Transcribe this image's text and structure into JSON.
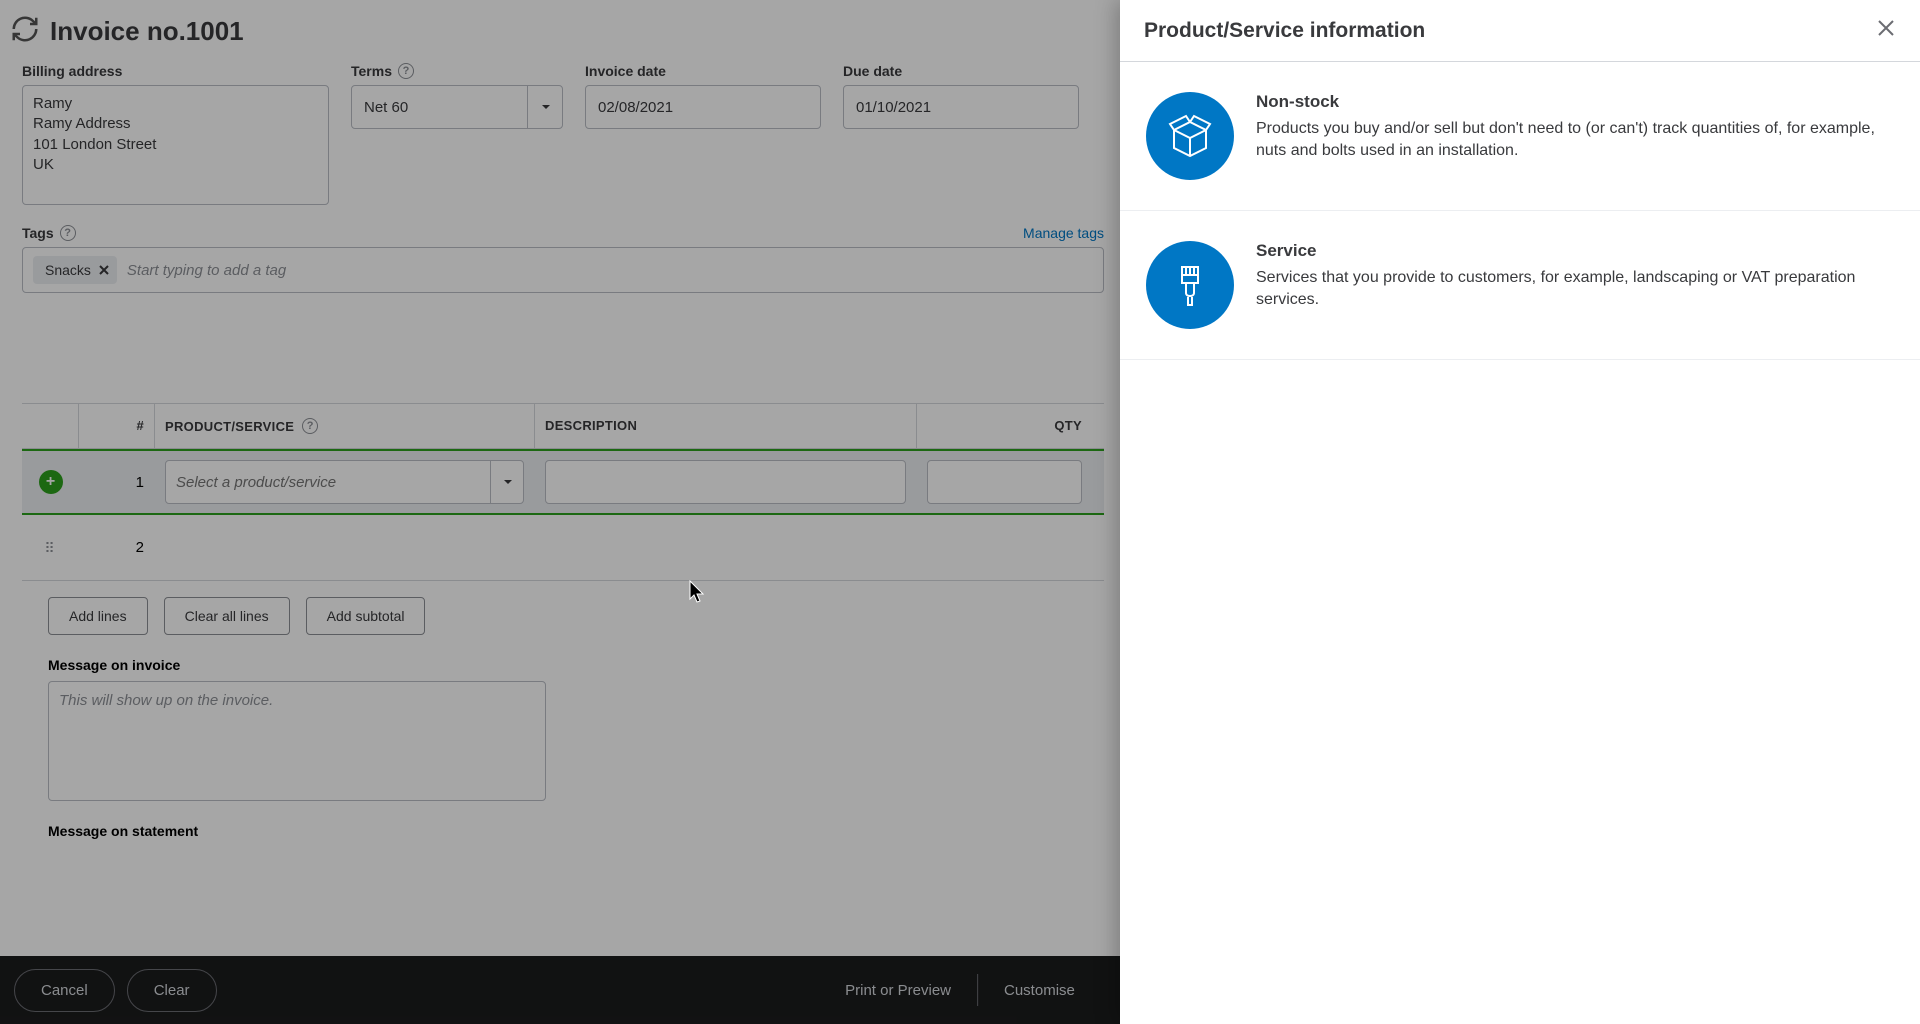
{
  "header": {
    "title": "Invoice no.1001"
  },
  "fields": {
    "billing_label": "Billing address",
    "billing_value": "Ramy\nRamy Address\n101 London Street\nUK",
    "terms_label": "Terms",
    "terms_value": "Net 60",
    "invoice_date_label": "Invoice date",
    "invoice_date_value": "02/08/2021",
    "due_date_label": "Due date",
    "due_date_value": "01/10/2021"
  },
  "tags": {
    "label": "Tags",
    "manage": "Manage tags",
    "chip": "Snacks",
    "placeholder": "Start typing to add a tag"
  },
  "table": {
    "headers": {
      "num": "#",
      "product": "PRODUCT/SERVICE",
      "description": "DESCRIPTION",
      "qty": "QTY"
    },
    "rows": [
      {
        "num": "1",
        "product_placeholder": "Select a product/service"
      },
      {
        "num": "2"
      }
    ],
    "actions": {
      "add_lines": "Add lines",
      "clear_all": "Clear all lines",
      "add_subtotal": "Add subtotal"
    }
  },
  "messages": {
    "invoice_label": "Message on invoice",
    "invoice_placeholder": "This will show up on the invoice.",
    "statement_label": "Message on statement"
  },
  "footer": {
    "cancel": "Cancel",
    "clear": "Clear",
    "print": "Print or Preview",
    "customise": "Customise"
  },
  "panel": {
    "title": "Product/Service information",
    "options": [
      {
        "title": "Non-stock",
        "desc": "Products you buy and/or sell but don't need to (or can't) track quantities of, for example, nuts and bolts used in an installation."
      },
      {
        "title": "Service",
        "desc": "Services that you provide to customers, for example, landscaping or VAT preparation services."
      }
    ]
  }
}
